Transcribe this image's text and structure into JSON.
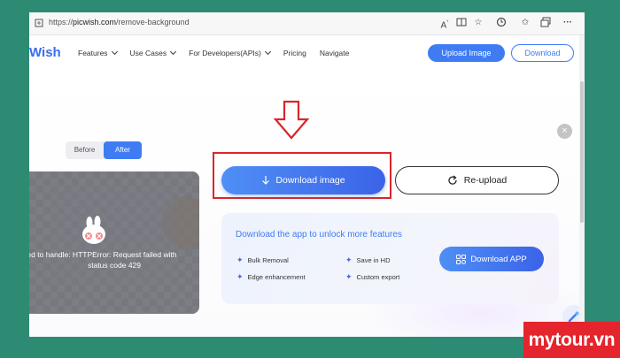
{
  "browser": {
    "url_scheme": "https://",
    "url_host": "picwish.com",
    "url_path": "/remove-background",
    "toolbar_icons": [
      "read-aloud-icon",
      "split-screen-icon",
      "favorite-icon",
      "extension-icon",
      "favorites-list-icon",
      "collections-icon",
      "more-icon"
    ]
  },
  "site": {
    "logo": "Wish",
    "menu": [
      {
        "label": "Features",
        "has_caret": true
      },
      {
        "label": "Use Cases",
        "has_caret": true
      },
      {
        "label": "For Developers(APIs)",
        "has_caret": true
      },
      {
        "label": "Pricing",
        "has_caret": false
      },
      {
        "label": "Navigate",
        "has_caret": false
      }
    ],
    "upload_label": "Upload Image",
    "download_label": "Download"
  },
  "editor": {
    "close_symbol": "×",
    "toggle": {
      "before": "Before",
      "after": "After",
      "active": "After"
    },
    "error_line1": "ed to handle: HTTPError: Request failed with",
    "error_line2": "status code 429",
    "download_image_label": "Download image",
    "reupload_label": "Re-upload"
  },
  "promo": {
    "title": "Download the app to unlock more features",
    "features": [
      "Bulk Removal",
      "Save in HD",
      "Edge enhancement",
      "Custom export"
    ],
    "button_label": "Download APP"
  },
  "watermark": "mytour.vn",
  "colors": {
    "accent": "#3f7cf4",
    "highlight": "#d9262b",
    "background": "#2e8b73",
    "watermark_bg": "#e4252d"
  }
}
